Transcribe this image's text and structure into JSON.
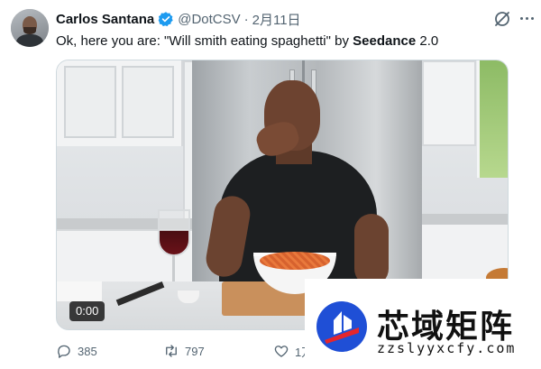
{
  "author": {
    "name": "Carlos Santana",
    "handle": "@DotCSV",
    "separator": "·",
    "date": "2月11日",
    "verified": true,
    "verified_color": "#1d9bf0"
  },
  "tweet": {
    "text_before": "Ok, here you are: \"Will smith eating spaghetti\" by ",
    "text_bold": "Seedance",
    "text_after": " 2.0"
  },
  "media": {
    "type": "video",
    "timestamp": "0:00"
  },
  "actions": {
    "replies": "385",
    "retweets": "797",
    "likes_partial": "1万"
  },
  "icons": [
    "verified-badge-icon",
    "grok-icon",
    "more-icon",
    "reply-icon",
    "retweet-icon",
    "like-icon"
  ],
  "watermark": {
    "cn_text": "芯域矩阵",
    "url": "zzslyyxcfy.com",
    "colors": {
      "blue": "#1f4fd6",
      "red": "#e5262c"
    }
  }
}
